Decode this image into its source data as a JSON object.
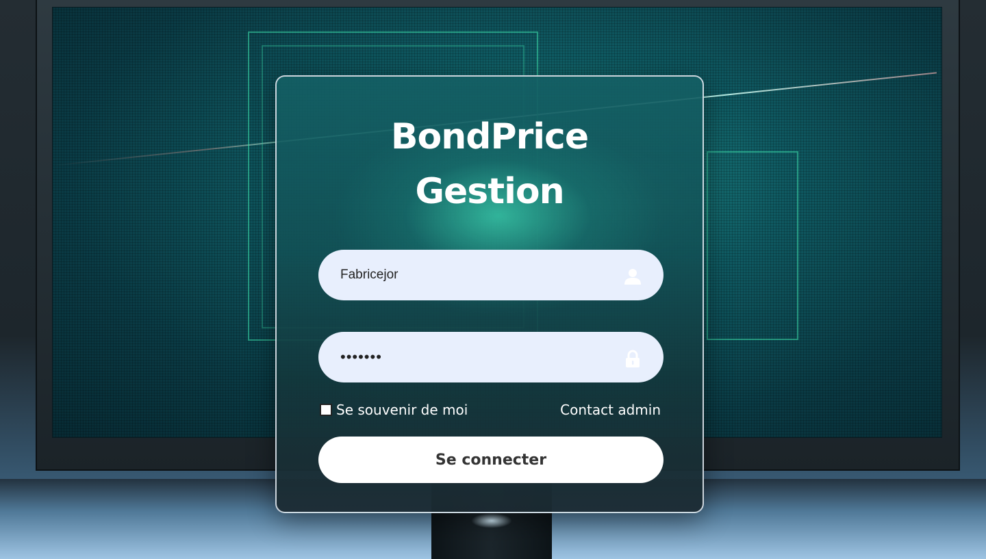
{
  "app": {
    "title_line1": "BondPrice",
    "title_line2": "Gestion"
  },
  "login": {
    "username_value": "Fabricejor",
    "password_masked": "•••••••",
    "user_icon": "user-icon",
    "lock_icon": "lock-icon",
    "remember_label": "Se souvenir de moi",
    "remember_checked": false,
    "contact_label": "Contact admin",
    "submit_label": "Se connecter"
  },
  "colors": {
    "input_bg": "#e8effd",
    "card_border": "#e1e8f0",
    "button_bg": "#ffffff",
    "title_text": "#ffffff"
  }
}
